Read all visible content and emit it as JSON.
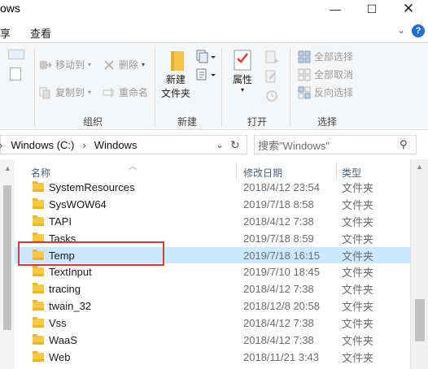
{
  "window": {
    "title": "ows",
    "minimize": "—",
    "maximize": "☐",
    "close": "✕"
  },
  "tabs": [
    {
      "label": "享"
    },
    {
      "label": "查看"
    }
  ],
  "ribbon": {
    "organize": {
      "move_to": "移动到",
      "copy_to": "复制到",
      "delete": "删除",
      "rename": "重命名",
      "group_label": "组织"
    },
    "new": {
      "new_folder_line1": "新建",
      "new_folder_line2": "文件夹",
      "group_label": "新建"
    },
    "open": {
      "properties": "属性",
      "group_label": "打开"
    },
    "select": {
      "select_all": "全部选择",
      "select_none": "全部取消",
      "invert": "反向选择",
      "group_label": "选择"
    }
  },
  "address": {
    "crumb1": "Windows (C:)",
    "crumb2": "Windows",
    "search_placeholder": "搜索\"Windows\""
  },
  "columns": {
    "name": "名称",
    "date": "修改日期",
    "type": "类型"
  },
  "files": [
    {
      "name": "SystemResources",
      "date": "2018/4/12 23:54",
      "type": "文件夹"
    },
    {
      "name": "SysWOW64",
      "date": "2019/7/18 8:58",
      "type": "文件夹"
    },
    {
      "name": "TAPI",
      "date": "2018/4/12 7:38",
      "type": "文件夹"
    },
    {
      "name": "Tasks",
      "date": "2019/7/18 8:59",
      "type": "文件夹"
    },
    {
      "name": "Temp",
      "date": "2019/7/18 16:15",
      "type": "文件夹",
      "selected": true
    },
    {
      "name": "TextInput",
      "date": "2019/7/10 18:45",
      "type": "文件夹"
    },
    {
      "name": "tracing",
      "date": "2018/4/12 7:38",
      "type": "文件夹"
    },
    {
      "name": "twain_32",
      "date": "2018/12/8 20:58",
      "type": "文件夹"
    },
    {
      "name": "Vss",
      "date": "2018/4/12 7:38",
      "type": "文件夹"
    },
    {
      "name": "WaaS",
      "date": "2018/4/12 7:38",
      "type": "文件夹"
    },
    {
      "name": "Web",
      "date": "2018/11/21 3:43",
      "type": "文件夹"
    }
  ],
  "colors": {
    "selection": "#cce8ff",
    "highlight_box": "#d83a3a",
    "accent": "#1f6fd0"
  }
}
